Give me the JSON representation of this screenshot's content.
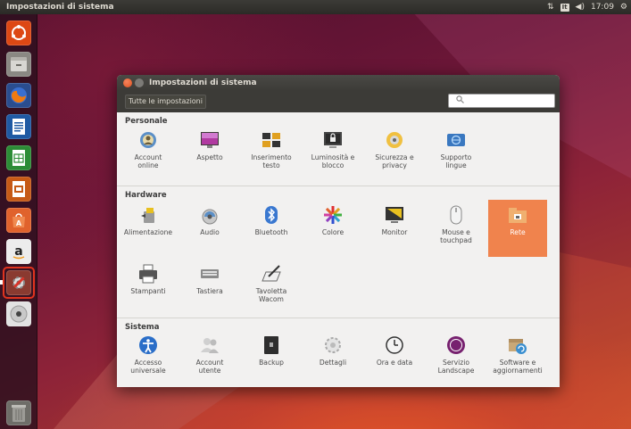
{
  "top_panel": {
    "app_title": "Impostazioni di sistema",
    "network_indicator": "⇅",
    "keyboard_layout": "It",
    "volume_icon": "◀)",
    "clock": "17:09",
    "settings_gear": "⚙"
  },
  "launcher": [
    {
      "name": "dash-home-icon",
      "color": "#dd4814",
      "glyph": "◎"
    },
    {
      "name": "files-icon",
      "color": "#8a8883",
      "glyph": "▭"
    },
    {
      "name": "firefox-icon",
      "color": "#e66000",
      "glyph": "●"
    },
    {
      "name": "libreoffice-writer-icon",
      "color": "#2a6fb0",
      "glyph": "≡"
    },
    {
      "name": "libreoffice-calc-icon",
      "color": "#2c9c3a",
      "glyph": "▦"
    },
    {
      "name": "libreoffice-impress-icon",
      "color": "#d7651a",
      "glyph": "▣"
    },
    {
      "name": "ubuntu-software-center-icon",
      "color": "#e0622c",
      "glyph": "A"
    },
    {
      "name": "amazon-icon",
      "color": "#e6e6e6",
      "glyph": "a"
    },
    {
      "name": "system-settings-icon",
      "color": "#c33a2c",
      "glyph": "⚙"
    },
    {
      "name": "dvd-drive-icon",
      "color": "#d8d8d8",
      "glyph": "◉"
    }
  ],
  "trash_icon": "trash-icon",
  "window": {
    "title": "Impostazioni di sistema",
    "all_settings_button": "Tutte le impostazioni",
    "search_placeholder": "",
    "sections": {
      "personale": "Personale",
      "hardware": "Hardware",
      "sistema": "Sistema"
    },
    "personale_items": [
      {
        "label": "Account\nonline",
        "icon": "online-accounts-icon"
      },
      {
        "label": "Aspetto",
        "icon": "appearance-icon"
      },
      {
        "label": "Inserimento\ntesto",
        "icon": "text-entry-icon"
      },
      {
        "label": "Luminosità e\nblocco",
        "icon": "brightness-lock-icon"
      },
      {
        "label": "Sicurezza e\nprivacy",
        "icon": "security-privacy-icon"
      },
      {
        "label": "Supporto\nlingue",
        "icon": "language-support-icon"
      }
    ],
    "hardware_items": [
      {
        "label": "Alimentazione",
        "icon": "power-icon"
      },
      {
        "label": "Audio",
        "icon": "sound-icon"
      },
      {
        "label": "Bluetooth",
        "icon": "bluetooth-icon"
      },
      {
        "label": "Colore",
        "icon": "color-icon"
      },
      {
        "label": "Monitor",
        "icon": "displays-icon"
      },
      {
        "label": "Mouse e\ntouchpad",
        "icon": "mouse-touchpad-icon"
      },
      {
        "label": "Rete",
        "icon": "network-icon",
        "selected": true
      },
      {
        "label": "Stampanti",
        "icon": "printers-icon"
      },
      {
        "label": "Tastiera",
        "icon": "keyboard-icon"
      },
      {
        "label": "Tavoletta\nWacom",
        "icon": "wacom-tablet-icon"
      }
    ],
    "sistema_items": [
      {
        "label": "Accesso\nuniversale",
        "icon": "universal-access-icon"
      },
      {
        "label": "Account\nutente",
        "icon": "user-accounts-icon"
      },
      {
        "label": "Backup",
        "icon": "backup-icon"
      },
      {
        "label": "Dettagli",
        "icon": "details-icon"
      },
      {
        "label": "Ora e data",
        "icon": "time-date-icon"
      },
      {
        "label": "Servizio\nLandscape",
        "icon": "landscape-service-icon"
      },
      {
        "label": "Software e\naggiornamenti",
        "icon": "software-updates-icon"
      }
    ]
  },
  "colors": {
    "accent_orange": "#f0834d",
    "panel_dark": "#3c3b37",
    "launcher_highlight": "#e0331e"
  }
}
